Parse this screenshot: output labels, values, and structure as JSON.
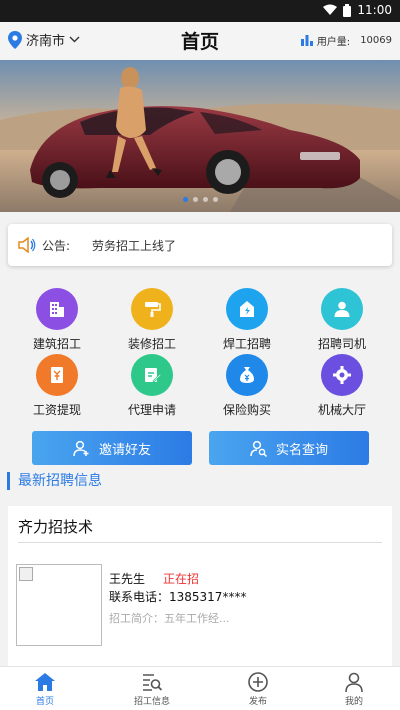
{
  "status_bar": {
    "time": "11:00"
  },
  "header": {
    "city": "济南市",
    "title": "首页",
    "users_label": "用户量:",
    "users_count": "10069"
  },
  "notice": {
    "label": "公告:",
    "text": "劳务招工上线了"
  },
  "services": [
    {
      "label": "建筑招工",
      "icon": "building-icon",
      "color": "#8b4fe4"
    },
    {
      "label": "装修招工",
      "icon": "paint-roller-icon",
      "color": "#f0b21c"
    },
    {
      "label": "焊工招聘",
      "icon": "welding-icon",
      "color": "#1ea4ef"
    },
    {
      "label": "招聘司机",
      "icon": "driver-icon",
      "color": "#2fc3d6"
    },
    {
      "label": "工资提现",
      "icon": "withdraw-icon",
      "color": "#f07a2a"
    },
    {
      "label": "代理申请",
      "icon": "apply-icon",
      "color": "#2ec98a"
    },
    {
      "label": "保险购买",
      "icon": "money-bag-icon",
      "color": "#1f88e8"
    },
    {
      "label": "机械大厅",
      "icon": "gear-icon",
      "color": "#6b4fe0"
    }
  ],
  "actions": {
    "invite": "邀请好友",
    "verify": "实名查询"
  },
  "section_title": "最新招聘信息",
  "job": {
    "company": "齐力招技术",
    "contact": "王先生",
    "status": "正在招",
    "phone": "联系电话：1385317****",
    "intro": "招工简介：五年工作经..."
  },
  "tabs": [
    {
      "label": "首页",
      "icon": "home-icon"
    },
    {
      "label": "招工信息",
      "icon": "list-search-icon"
    },
    {
      "label": "发布",
      "icon": "plus-circle-icon"
    },
    {
      "label": "我的",
      "icon": "user-icon"
    }
  ],
  "colors": {
    "accent": "#2c7be5",
    "status_red": "#e33333"
  }
}
